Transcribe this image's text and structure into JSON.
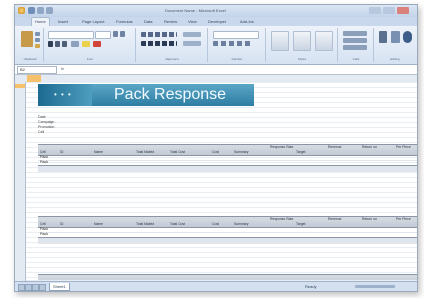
{
  "window": {
    "document_title": "Document Name - Microsoft Excel"
  },
  "ribbon_tabs": [
    "Home",
    "Insert",
    "Page Layout",
    "Formulas",
    "Data",
    "Review",
    "View",
    "Developer",
    "Add-Ins"
  ],
  "ribbon_groups": [
    "Clipboard",
    "Font",
    "Alignment",
    "Number",
    "Styles",
    "Cells",
    "Editing"
  ],
  "formula_bar": {
    "name_box": "B2",
    "fx": "fx"
  },
  "banner": {
    "dots": "• • •",
    "title": "Pack Response"
  },
  "meta": [
    {
      "key": "Date",
      "value": ""
    },
    {
      "key": "Campaign",
      "value": ""
    },
    {
      "key": "Promotion",
      "value": ""
    },
    {
      "key": "Cell",
      "value": ""
    }
  ],
  "table_headers": {
    "cell": "Cell",
    "id": "ID",
    "name": "Name",
    "total_mailed": "Total Mailed",
    "total_cost": "Total Cost",
    "cost": "Cost",
    "response_rate": "Response Rate",
    "summary": "Summary",
    "target": "Target",
    "revenue": "Revenue",
    "return_on": "Return on",
    "per_piece": "Per Piece"
  },
  "tables": [
    {
      "rows": [
        {
          "cell": "Pack",
          "id": "",
          "name": "",
          "mailed": "",
          "total_cost": "",
          "cost": "",
          "rr": "",
          "target": "",
          "revenue": "",
          "roi": "",
          "pp": ""
        },
        {
          "cell": "Pack",
          "id": "",
          "name": "",
          "mailed": "",
          "total_cost": "",
          "cost": "",
          "rr": "",
          "target": "",
          "revenue": "",
          "roi": "",
          "pp": ""
        }
      ]
    },
    {
      "rows": [
        {
          "cell": "Pack",
          "id": "",
          "name": "",
          "mailed": "",
          "total_cost": "",
          "cost": "",
          "rr": "",
          "target": "",
          "revenue": "",
          "roi": "",
          "pp": ""
        },
        {
          "cell": "Pack",
          "id": "",
          "name": "",
          "mailed": "",
          "total_cost": "",
          "cost": "",
          "rr": "",
          "target": "",
          "revenue": "",
          "roi": "",
          "pp": ""
        }
      ]
    }
  ],
  "status_bar": {
    "sheet_tab": "Sheet1",
    "ready": "Ready"
  }
}
